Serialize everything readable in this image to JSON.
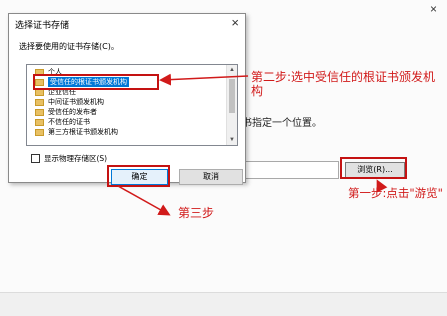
{
  "background_window": {
    "close_glyph": "×",
    "hint_text": "书指定一个位置。",
    "browse_label": "浏览(R)..."
  },
  "dialog": {
    "title": "选择证书存储",
    "close_glyph": "×",
    "prompt": "选择要使用的证书存储(C)。",
    "stores": [
      {
        "label": "个人"
      },
      {
        "label": "受信任的根证书颁发机构",
        "selected": true
      },
      {
        "label": "企业信任"
      },
      {
        "label": "中间证书颁发机构"
      },
      {
        "label": "受信任的发布者"
      },
      {
        "label": "不信任的证书"
      },
      {
        "label": "第三方根证书颁发机构"
      }
    ],
    "show_physical_label": "显示物理存储区(S)",
    "show_physical_checked": false,
    "ok_label": "确定",
    "cancel_label": "取消"
  },
  "annotations": {
    "step2": "第二步:选中受信任的根证书颁发机构",
    "step1": "第一步:点击\"游览\"",
    "step3": "第三步",
    "color": "#d11a1a"
  }
}
